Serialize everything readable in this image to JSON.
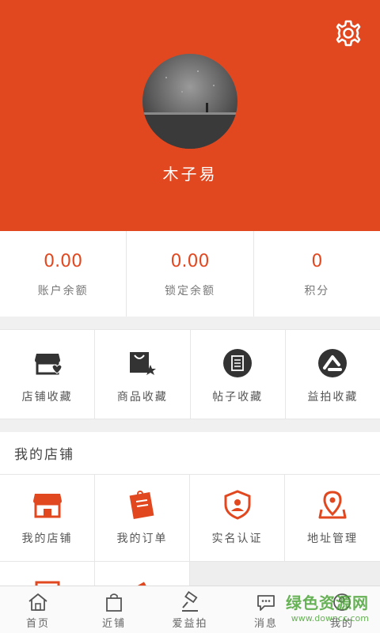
{
  "profile": {
    "username": "木子易"
  },
  "stats": [
    {
      "value": "0.00",
      "label": "账户余额"
    },
    {
      "value": "0.00",
      "label": "锁定余额"
    },
    {
      "value": "0",
      "label": "积分"
    }
  ],
  "favorites": [
    {
      "label": "店铺收藏",
      "icon": "shop-favorite-icon"
    },
    {
      "label": "商品收藏",
      "icon": "bag-star-icon"
    },
    {
      "label": "帖子收藏",
      "icon": "document-circle-icon"
    },
    {
      "label": "益拍收藏",
      "icon": "yipai-logo-icon"
    }
  ],
  "my_shop": {
    "title": "我的店铺",
    "items": [
      {
        "label": "我的店铺",
        "icon": "store-icon"
      },
      {
        "label": "我的订单",
        "icon": "orders-icon"
      },
      {
        "label": "实名认证",
        "icon": "verify-shield-icon"
      },
      {
        "label": "地址管理",
        "icon": "map-pin-icon"
      }
    ]
  },
  "tabbar": [
    {
      "label": "首页",
      "icon": "home-icon"
    },
    {
      "label": "近铺",
      "icon": "shopping-bag-icon"
    },
    {
      "label": "爱益拍",
      "icon": "auction-hammer-icon"
    },
    {
      "label": "消息",
      "icon": "message-icon"
    },
    {
      "label": "我的",
      "icon": "user-icon"
    }
  ],
  "watermark": {
    "main": "绿色资源网",
    "sub": "www.downcc.com"
  },
  "colors": {
    "accent": "#e24820",
    "watermark": "#4ea63a"
  }
}
